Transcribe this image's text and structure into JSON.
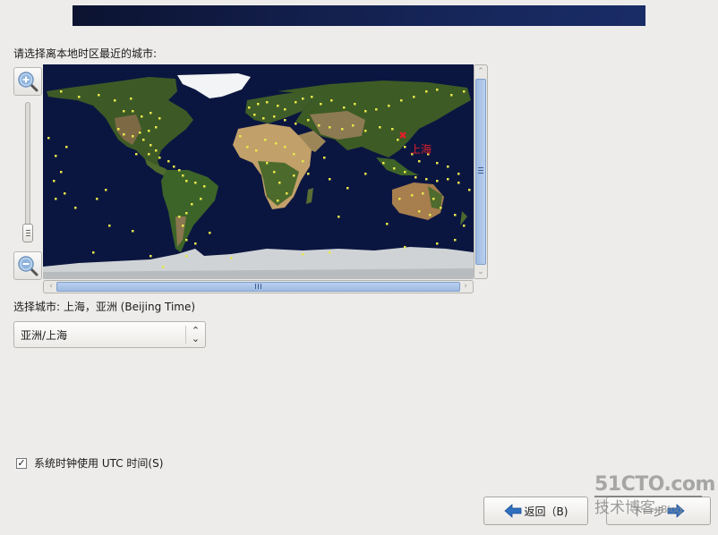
{
  "banner": {
    "colors": [
      "#0b1330",
      "#1a2c66"
    ]
  },
  "prompt": "请选择离本地时区最近的城市:",
  "map": {
    "selected_city": "上海",
    "selected_marker_color": "#e0202a",
    "city_dot_color": "#e8e84a",
    "zoom_in_icon": "magnifier-plus-icon",
    "zoom_out_icon": "magnifier-minus-icon"
  },
  "city_selection": {
    "label": "选择城市: 上海，亚洲 (Beijing Time)",
    "combo_value": "亚洲/上海"
  },
  "utc_checkbox": {
    "label": "系统时钟使用 UTC 时间(S)",
    "checked": true,
    "check_glyph": "✓"
  },
  "buttons": {
    "back": {
      "label": "返回（B)",
      "icon": "arrow-left-icon"
    },
    "next": {
      "label": "下一步",
      "icon": "arrow-right-icon"
    }
  },
  "watermark": {
    "top": "51CTO.com",
    "bottom": "技术博客",
    "blog": "Blog"
  }
}
